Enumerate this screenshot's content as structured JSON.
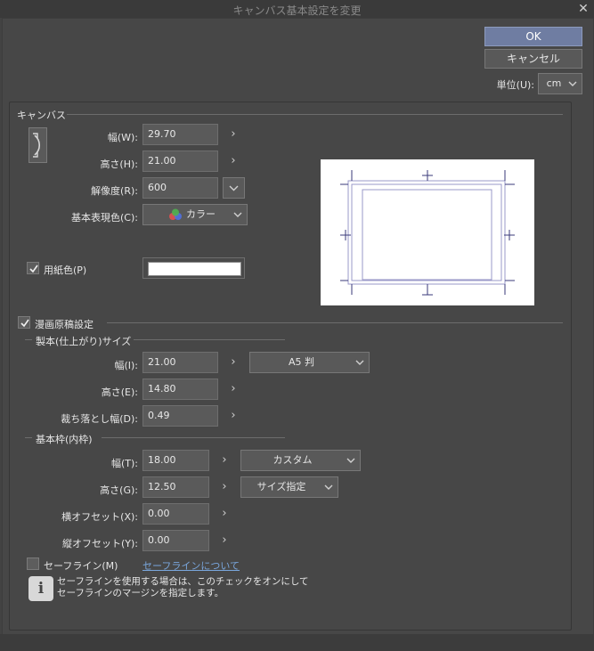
{
  "window": {
    "title": "キャンバス基本設定を変更"
  },
  "buttons": {
    "ok": "OK",
    "cancel": "キャンセル"
  },
  "unit": {
    "label": "単位(U):",
    "value": "cm"
  },
  "canvas": {
    "section_title": "キャンバス",
    "width_label": "幅(W):",
    "width_value": "29.70",
    "height_label": "高さ(H):",
    "height_value": "21.00",
    "resolution_label": "解像度(R):",
    "resolution_value": "600",
    "colormode_label": "基本表現色(C):",
    "colormode_value": "カラー",
    "paper_color_label": "用紙色(P)",
    "paper_color_checked": true,
    "paper_color": "#ffffff"
  },
  "manga": {
    "checkbox_label": "漫画原稿設定",
    "checked": true,
    "trim": {
      "section_title": "製本(仕上がり)サイズ",
      "width_label": "幅(I):",
      "width_value": "21.00",
      "height_label": "高さ(E):",
      "height_value": "14.80",
      "bleed_label": "裁ち落とし幅(D):",
      "bleed_value": "0.49",
      "preset_value": "A5 判"
    },
    "frame": {
      "section_title": "基本枠(内枠)",
      "width_label": "幅(T):",
      "width_value": "18.00",
      "height_label": "高さ(G):",
      "height_value": "12.50",
      "hoffset_label": "横オフセット(X):",
      "hoffset_value": "0.00",
      "voffset_label": "縦オフセット(Y):",
      "voffset_value": "0.00",
      "preset_value": "カスタム",
      "size_mode_value": "サイズ指定"
    },
    "safe_line": {
      "checkbox_label": "セーフライン(M)",
      "checked": false,
      "link_text": "セーフラインについて",
      "info_line1": "セーフラインを使用する場合は、このチェックをオンにして",
      "info_line2": "セーフラインのマージンを指定します。"
    }
  },
  "icons": {
    "close": "close-icon",
    "orientation": "rotate-orientation-icon",
    "chevron_right": "chevron-right-icon",
    "chevron_down": "chevron-down-icon",
    "color_mode": "color-circles-icon",
    "checkmark": "checkmark-icon",
    "info": "info-icon"
  },
  "colors": {
    "ok_button": "#6f7da2",
    "link": "#79a6dc",
    "preview_guides": "#9a98c8",
    "color_red": "#e05050",
    "color_green": "#50b050",
    "color_blue": "#5070e0"
  }
}
